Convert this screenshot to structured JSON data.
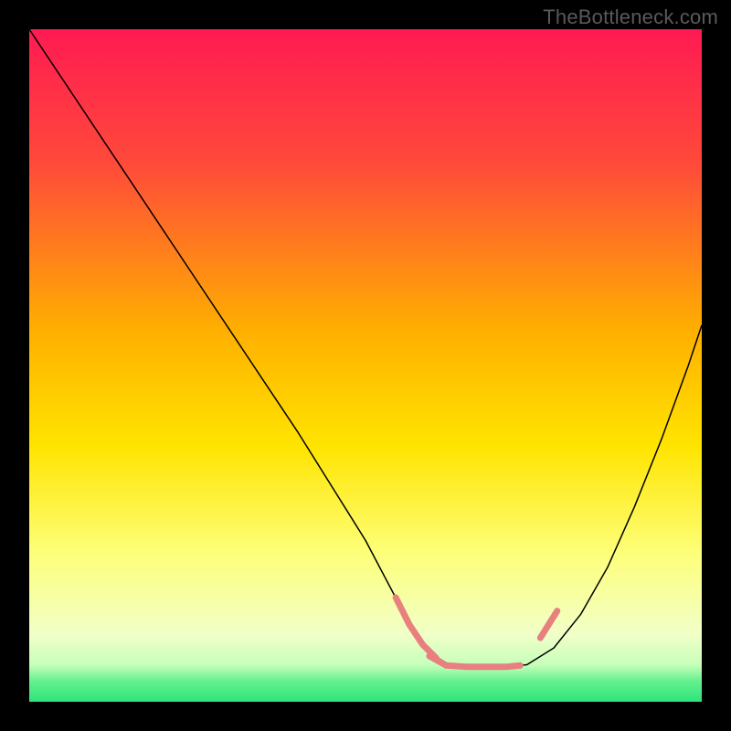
{
  "watermark": "TheBottleneck.com",
  "chart_data": {
    "type": "line",
    "title": "",
    "xlabel": "",
    "ylabel": "",
    "xlim": [
      0,
      100
    ],
    "ylim": [
      0,
      100
    ],
    "gradient_stops": [
      {
        "offset": 0,
        "color": "#ff1a52"
      },
      {
        "offset": 0.2,
        "color": "#ff4a3a"
      },
      {
        "offset": 0.45,
        "color": "#ffb000"
      },
      {
        "offset": 0.62,
        "color": "#ffe400"
      },
      {
        "offset": 0.78,
        "color": "#fdff7a"
      },
      {
        "offset": 0.9,
        "color": "#f1ffc8"
      },
      {
        "offset": 0.945,
        "color": "#c7ffba"
      },
      {
        "offset": 0.97,
        "color": "#63f08e"
      },
      {
        "offset": 1.0,
        "color": "#2de57a"
      }
    ],
    "series": [
      {
        "name": "bottleneck-curve",
        "color": "#000000",
        "width": 1.5,
        "x": [
          0,
          5,
          10,
          15,
          20,
          25,
          30,
          35,
          40,
          45,
          50,
          55,
          57,
          60,
          63,
          66,
          70,
          74,
          78,
          82,
          86,
          90,
          94,
          98,
          100
        ],
        "y": [
          100,
          92.5,
          85,
          77.5,
          70,
          62.5,
          55,
          47.5,
          40,
          32,
          24,
          14.5,
          11,
          7,
          5.2,
          5.2,
          5.2,
          5.5,
          8,
          13,
          20,
          29,
          39,
          50,
          56
        ]
      },
      {
        "name": "highlight-left-dip",
        "color": "#e88080",
        "width": 7,
        "linecap": "round",
        "x": [
          54.5,
          56.5,
          58.5,
          60.5
        ],
        "y": [
          15.5,
          11.5,
          8.5,
          6.5
        ]
      },
      {
        "name": "highlight-flat",
        "color": "#e88080",
        "width": 7,
        "linecap": "round",
        "x": [
          59.5,
          62,
          65,
          68,
          71,
          73
        ],
        "y": [
          6.8,
          5.4,
          5.2,
          5.2,
          5.2,
          5.4
        ]
      },
      {
        "name": "highlight-right-dip",
        "color": "#e88080",
        "width": 7,
        "linecap": "round",
        "x": [
          76,
          78.5
        ],
        "y": [
          9.5,
          13.5
        ]
      }
    ]
  }
}
